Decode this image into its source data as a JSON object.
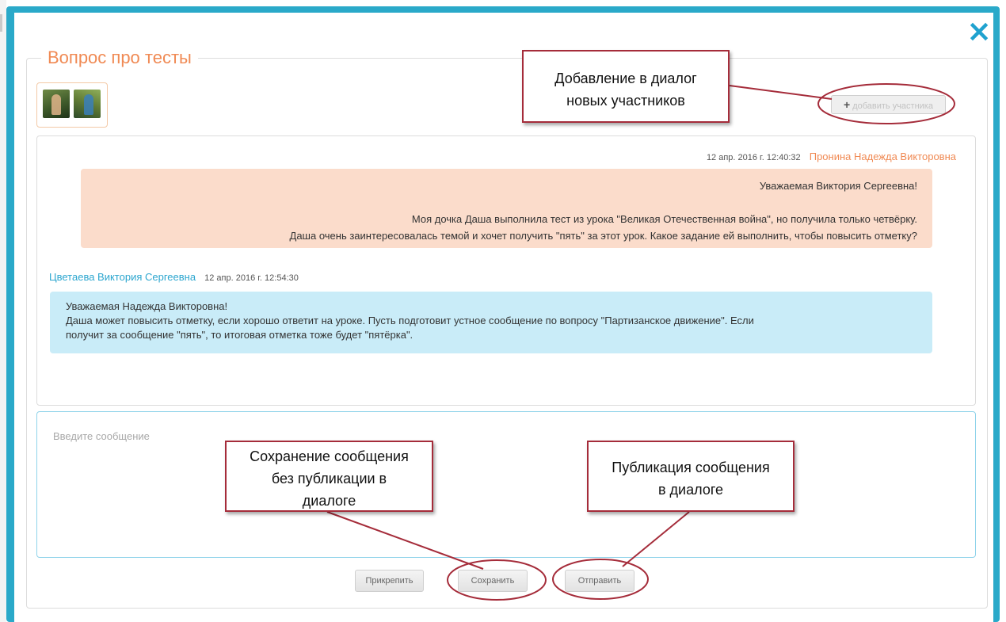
{
  "dialog": {
    "title": "Вопрос про тесты",
    "close_icon": "×"
  },
  "participants": {
    "add_button": "добавить участника",
    "avatars": [
      "avatar-1",
      "avatar-2"
    ]
  },
  "messages": [
    {
      "timestamp": "12 апр. 2016 г. 12:40:32",
      "author": "Пронина Надежда Викторовна",
      "lines": [
        "Уважаемая Виктория Сергеевна!",
        "Моя дочка Даша выполнила тест из урока \"Великая Отечественная война\", но получила только четвёрку.",
        "Даша очень заинтересовалась темой и хочет получить \"пять\" за этот урок. Какое задание ей выполнить, чтобы повысить отметку?"
      ]
    },
    {
      "author": "Цветаева Виктория Сергеевна",
      "timestamp": "12 апр. 2016 г. 12:54:30",
      "lines": [
        "Уважаемая Надежда Викторовна!",
        "Даша может повысить отметку, если хорошо ответит на уроке. Пусть подготовит устное сообщение по вопросу \"Партизанское движение\". Если",
        "получит за сообщение \"пять\", то итоговая отметка тоже будет \"пятёрка\"."
      ]
    }
  ],
  "composer": {
    "placeholder": "Введите сообщение"
  },
  "buttons": {
    "attach": "Прикрепить",
    "save": "Сохранить",
    "send": "Отправить"
  },
  "callouts": {
    "add_participants": [
      "Добавление в диалог",
      "новых участников"
    ],
    "save_draft": [
      "Сохранение сообщения",
      "без публикации в",
      "диалоге"
    ],
    "publish": [
      "Публикация сообщения",
      "в диалоге"
    ]
  },
  "colors": {
    "frame": "#2aa9c9",
    "accent_orange": "#f08a54",
    "accent_blue": "#2ca6cf",
    "bubble_peach": "#fbdccb",
    "bubble_blue": "#c9ecf8",
    "callout_border": "#a52c3a"
  }
}
